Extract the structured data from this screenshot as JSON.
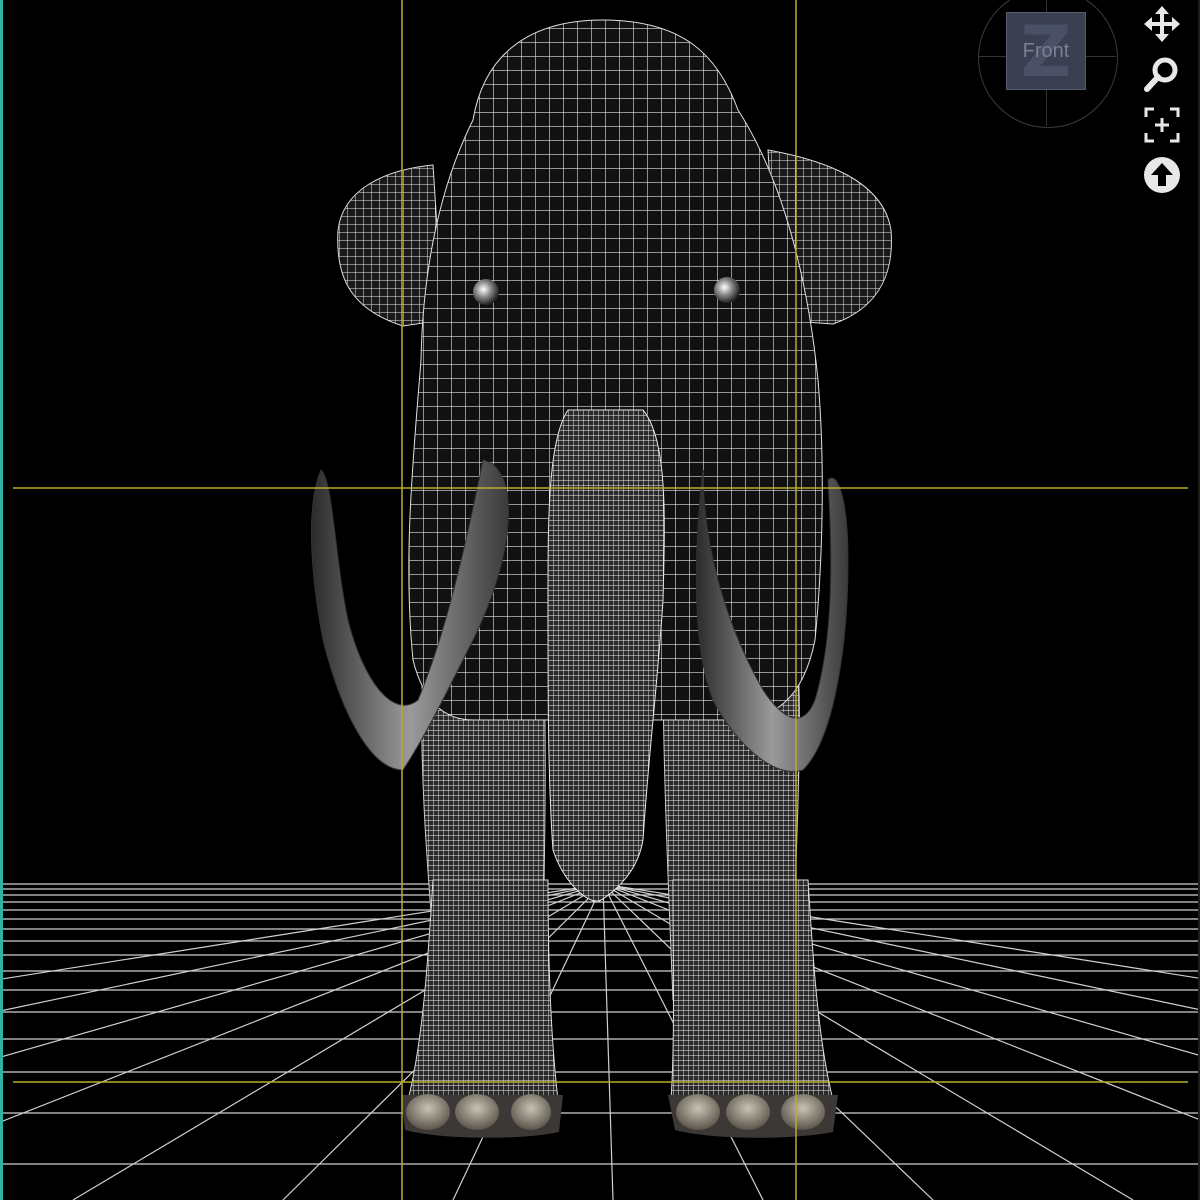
{
  "viewport": {
    "background": "#000000",
    "frame_accent": "#2bb3a6",
    "guide_color": "#b0a82a",
    "grid_color": "#e6e6e6"
  },
  "view_cube": {
    "face_letter": "Z",
    "face_label": "Front"
  },
  "nav_tools": [
    {
      "icon": "move-icon"
    },
    {
      "icon": "zoom-icon"
    },
    {
      "icon": "frame-icon"
    },
    {
      "icon": "reset-view-icon"
    }
  ],
  "scene": {
    "model": "mammoth-wireframe"
  }
}
